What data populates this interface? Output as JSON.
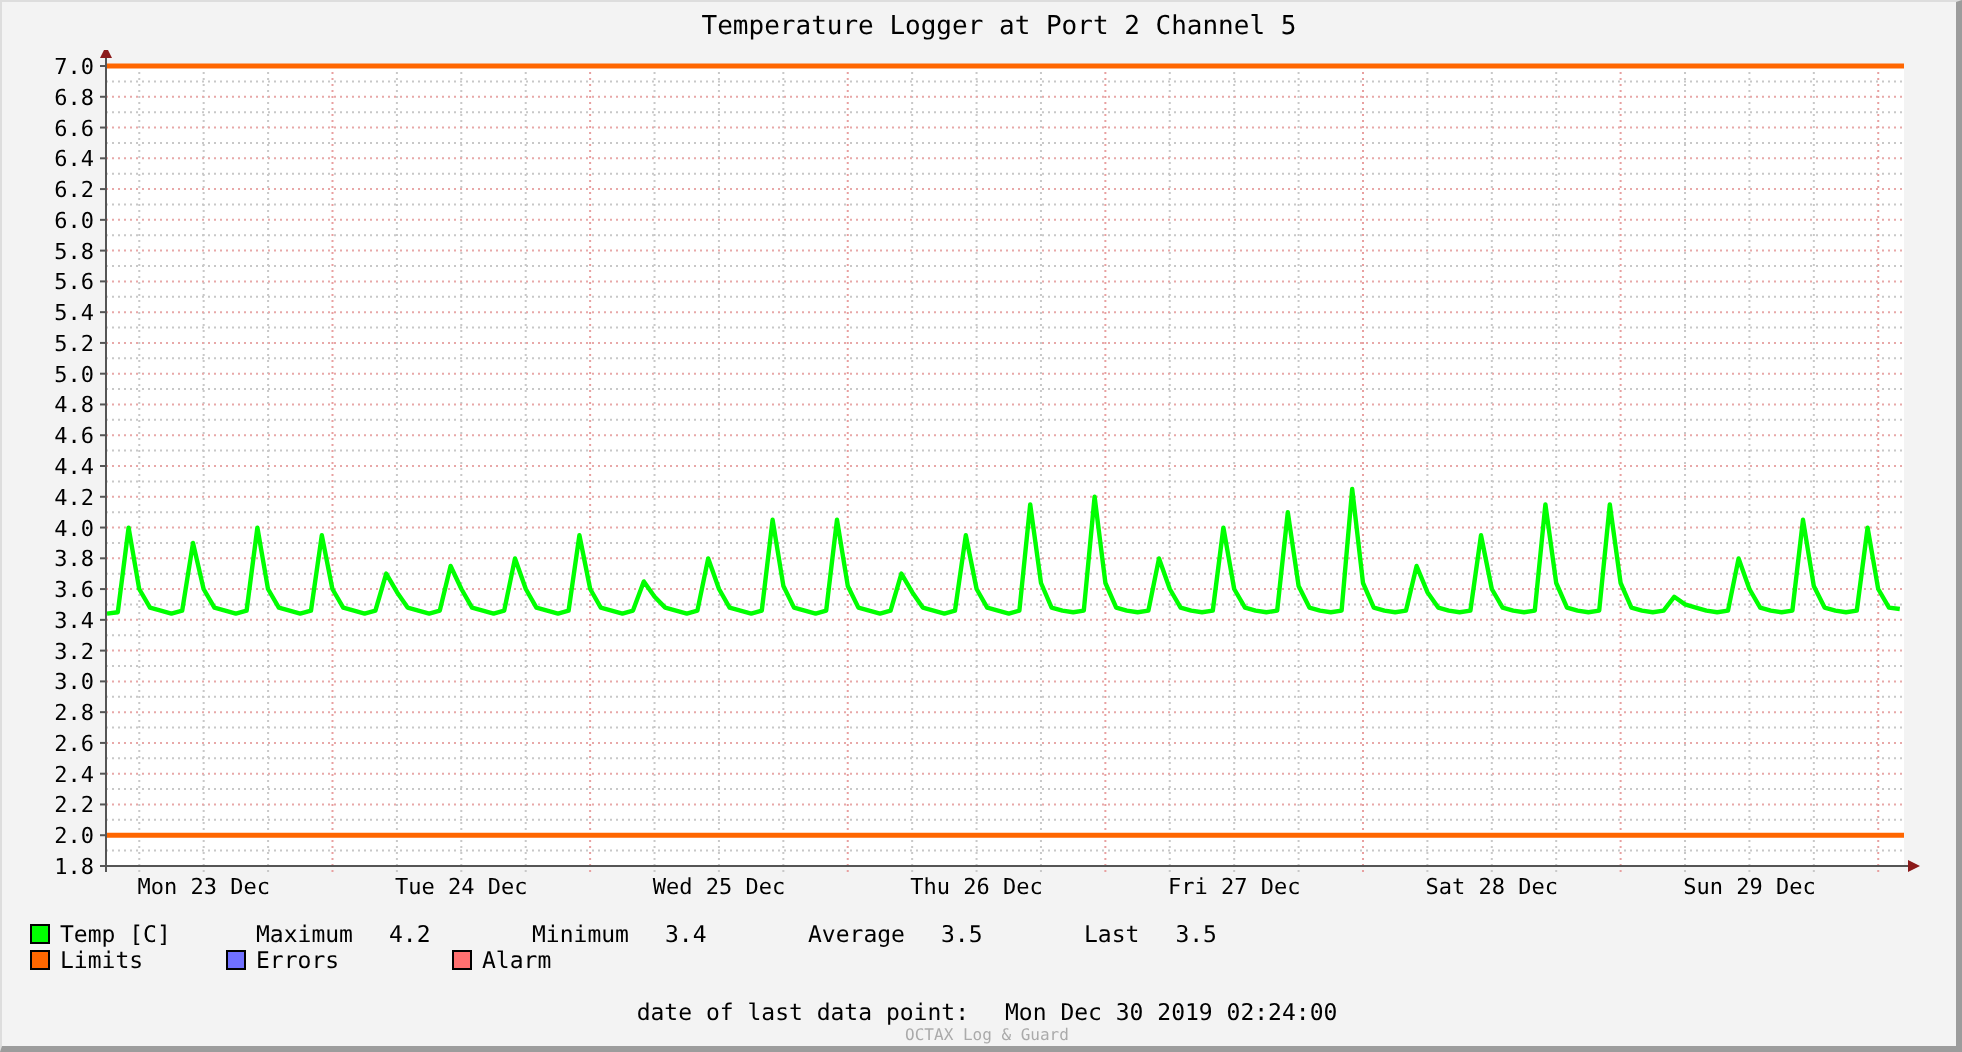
{
  "title": "Temperature Logger at Port 2 Channel 5",
  "chart_data": {
    "type": "line",
    "ylim": [
      1.8,
      7.0
    ],
    "categories": [
      null,
      null,
      null,
      null,
      null,
      null,
      null,
      null,
      null,
      "Mon 23 Dec",
      null,
      null,
      null,
      null,
      null,
      null,
      null,
      null,
      null,
      null,
      null,
      null,
      null,
      null,
      null,
      null,
      null,
      null,
      null,
      null,
      null,
      null,
      null,
      "Tue 24 Dec",
      null,
      null,
      null,
      null,
      null,
      null,
      null,
      null,
      null,
      null,
      null,
      null,
      null,
      null,
      null,
      null,
      null,
      null,
      null,
      null,
      null,
      null,
      null,
      "Wed 25 Dec",
      null,
      null,
      null,
      null,
      null,
      null,
      null,
      null,
      null,
      null,
      null,
      null,
      null,
      null,
      null,
      null,
      null,
      null,
      null,
      null,
      null,
      null,
      null,
      "Thu 26 Dec",
      null,
      null,
      null,
      null,
      null,
      null,
      null,
      null,
      null,
      null,
      null,
      null,
      null,
      null,
      null,
      null,
      null,
      null,
      null,
      null,
      null,
      null,
      null,
      "Fri 27 Dec",
      null,
      null,
      null,
      null,
      null,
      null,
      null,
      null,
      null,
      null,
      null,
      null,
      null,
      null,
      null,
      null,
      null,
      null,
      null,
      null,
      null,
      null,
      null,
      "Sat 28 Dec",
      null,
      null,
      null,
      null,
      null,
      null,
      null,
      null,
      null,
      null,
      null,
      null,
      null,
      null,
      null,
      null,
      null,
      null,
      null,
      null,
      null,
      null,
      null,
      "Sun 29 Dec",
      null,
      null,
      null,
      null,
      null,
      null,
      null,
      null,
      null,
      null,
      null,
      null,
      null,
      null
    ],
    "yticks": [
      {
        "value": 7,
        "label": "7.0"
      },
      6.8,
      6.6,
      6.4,
      6.2,
      {
        "value": 6,
        "label": "6.0"
      },
      5.8,
      5.6,
      5.4,
      5.2,
      {
        "value": 5,
        "label": "5.0"
      },
      4.8,
      4.6,
      4.4,
      4.2,
      {
        "value": 4,
        "label": "4.0"
      },
      3.8,
      3.6,
      3.4,
      3.2,
      {
        "value": 3,
        "label": "3.0"
      },
      2.8,
      2.6,
      2.4,
      2.2,
      {
        "value": 2,
        "label": "2.0"
      },
      1.8
    ],
    "grid": true,
    "series": [
      {
        "name": "Temp [C]",
        "color": "#00ff00",
        "values": [
          3.44,
          3.45,
          4.0,
          3.6,
          3.48,
          3.46,
          3.44,
          3.46,
          3.9,
          3.6,
          3.48,
          3.46,
          3.44,
          3.46,
          4.0,
          3.6,
          3.48,
          3.46,
          3.44,
          3.46,
          3.95,
          3.6,
          3.48,
          3.46,
          3.44,
          3.46,
          3.7,
          3.58,
          3.48,
          3.46,
          3.44,
          3.46,
          3.75,
          3.6,
          3.48,
          3.46,
          3.44,
          3.46,
          3.8,
          3.6,
          3.48,
          3.46,
          3.44,
          3.46,
          3.95,
          3.6,
          3.48,
          3.46,
          3.44,
          3.46,
          3.65,
          3.55,
          3.48,
          3.46,
          3.44,
          3.46,
          3.8,
          3.6,
          3.48,
          3.46,
          3.44,
          3.46,
          4.05,
          3.62,
          3.48,
          3.46,
          3.44,
          3.46,
          4.05,
          3.62,
          3.48,
          3.46,
          3.44,
          3.46,
          3.7,
          3.58,
          3.48,
          3.46,
          3.44,
          3.46,
          3.95,
          3.6,
          3.48,
          3.46,
          3.44,
          3.46,
          4.15,
          3.64,
          3.48,
          3.46,
          3.45,
          3.46,
          4.2,
          3.64,
          3.48,
          3.46,
          3.45,
          3.46,
          3.8,
          3.6,
          3.48,
          3.46,
          3.45,
          3.46,
          4.0,
          3.6,
          3.48,
          3.46,
          3.45,
          3.46,
          4.1,
          3.62,
          3.48,
          3.46,
          3.45,
          3.46,
          4.25,
          3.64,
          3.48,
          3.46,
          3.45,
          3.46,
          3.75,
          3.58,
          3.48,
          3.46,
          3.45,
          3.46,
          3.95,
          3.6,
          3.48,
          3.46,
          3.45,
          3.46,
          4.15,
          3.64,
          3.48,
          3.46,
          3.45,
          3.46,
          4.15,
          3.64,
          3.48,
          3.46,
          3.45,
          3.46,
          3.55,
          3.5,
          3.48,
          3.46,
          3.45,
          3.46,
          3.8,
          3.6,
          3.48,
          3.46,
          3.45,
          3.46,
          4.05,
          3.62,
          3.48,
          3.46,
          3.45,
          3.46,
          4.0,
          3.6,
          3.48,
          3.47
        ]
      }
    ],
    "ref_lines": [
      {
        "axis": "y",
        "value": 7.0
      },
      {
        "axis": "y",
        "value": 2.0
      }
    ]
  },
  "legend": [
    {
      "label": "Limits",
      "color": "#ff6600"
    },
    {
      "label": "Errors",
      "color": "#7070ff"
    },
    {
      "label": "Alarm",
      "color": "#ff7070"
    }
  ],
  "stats": [
    {
      "label": "Maximum",
      "value": "4.2"
    },
    {
      "label": "Minimum",
      "value": "3.4"
    },
    {
      "label": "Average",
      "value": "3.5"
    },
    {
      "label": "Last",
      "value": "3.5"
    }
  ],
  "last_data_point": {
    "label": "date of last data point:",
    "value": "Mon Dec 30 2019 02:24:00"
  },
  "footer_note": "OCTAX Log & Guard"
}
